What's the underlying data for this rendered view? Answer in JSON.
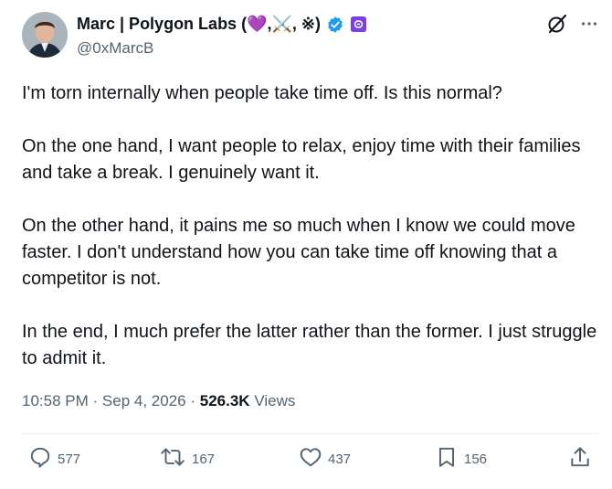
{
  "author": {
    "name": "Marc | Polygon Labs (💜,⚔️, ※)",
    "handle": "@0xMarcB"
  },
  "tweet": {
    "paragraphs": [
      "I'm torn internally when people take time off. Is this normal?",
      "On the one hand, I want people to relax, enjoy time with their families and take a break. I genuinely want it.",
      "On the other hand, it pains me so much when I know we could move faster. I don't understand how you can take time off knowing that a competitor is not.",
      "In the end, I much prefer the latter rather than the former. I just struggle to admit it."
    ]
  },
  "meta": {
    "time": "10:58 PM",
    "date": "Sep 4, 2026",
    "views_count": "526.3K",
    "views_label": "Views",
    "separator": "·"
  },
  "actions": {
    "replies": "577",
    "reposts": "167",
    "likes": "437",
    "bookmarks": "156"
  },
  "colors": {
    "verified_blue": "#1d9bf0",
    "affiliate_purple": "#7b3fe4",
    "text": "#0f1419",
    "secondary": "#536471"
  }
}
